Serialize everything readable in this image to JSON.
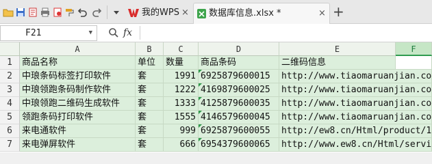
{
  "tabs": {
    "wps_label": "我的WPS",
    "file_label": "数据库信息.xlsx *",
    "close_glyph": "×",
    "add_glyph": "+"
  },
  "formula_bar": {
    "cell_ref": "F21",
    "fx_label": "fx",
    "content": ""
  },
  "columns": [
    "A",
    "B",
    "C",
    "D",
    "E",
    "F"
  ],
  "selected_column": "F",
  "rows": [
    {
      "num": "1",
      "a": "商品名称",
      "b": "单位",
      "c": "数量",
      "d": "商品条码",
      "e": "二维码信息"
    },
    {
      "num": "2",
      "a": "中琅条码标签打印软件",
      "b": "套",
      "c": "1991",
      "d": "6925879600015",
      "e": "http://www.tiaomaruanjian.co"
    },
    {
      "num": "3",
      "a": "中琅领跑条码制作软件",
      "b": "套",
      "c": "1222",
      "d": "4169879600025",
      "e": "http://www.tiaomaruanjian.co"
    },
    {
      "num": "4",
      "a": "中琅领跑二维码生成软件",
      "b": "套",
      "c": "1333",
      "d": "4125879600035",
      "e": "http://www.tiaomaruanjian.co"
    },
    {
      "num": "5",
      "a": "领跑条码打印软件",
      "b": "套",
      "c": "1555",
      "d": "4146579600045",
      "e": "http://www.tiaomaruanjian.co"
    },
    {
      "num": "6",
      "a": "来电通软件",
      "b": "套",
      "c": "999",
      "d": "6925879600055",
      "e": "http://ew8.cn/Html/product/1"
    },
    {
      "num": "7",
      "a": "来电弹屏软件",
      "b": "套",
      "c": "666",
      "d": "6954379600065",
      "e": "http://www.ew8.cn/Html/servi"
    }
  ]
}
